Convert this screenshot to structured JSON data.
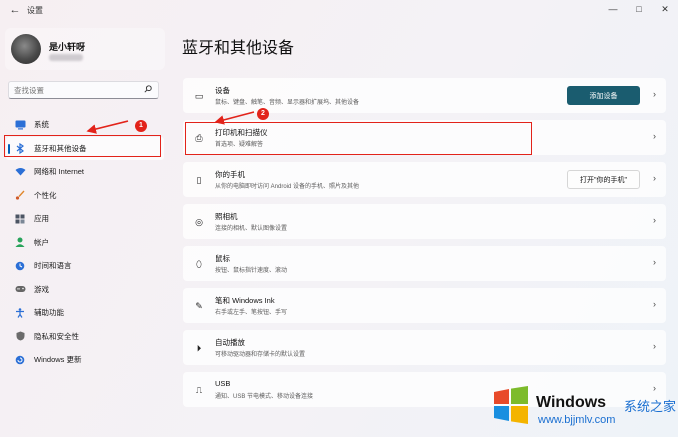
{
  "window": {
    "back_glyph": "←",
    "title": "设置",
    "minimize_glyph": "—",
    "maximize_glyph": "□",
    "close_glyph": "✕"
  },
  "profile": {
    "name": "是小轩呀"
  },
  "search": {
    "placeholder": "查找设置",
    "icon": "search-icon"
  },
  "sidebar": {
    "items": [
      {
        "label": "系统",
        "icon": "monitor-icon",
        "color": "#2b6fd6"
      },
      {
        "label": "蓝牙和其他设备",
        "icon": "bluetooth-icon",
        "color": "#2b6fd6",
        "active": true
      },
      {
        "label": "网络和 Internet",
        "icon": "wifi-icon",
        "color": "#2b6fd6"
      },
      {
        "label": "个性化",
        "icon": "brush-icon",
        "color": "#e0862a"
      },
      {
        "label": "应用",
        "icon": "apps-icon",
        "color": "#4c5563"
      },
      {
        "label": "帐户",
        "icon": "person-icon",
        "color": "#28a35a"
      },
      {
        "label": "时间和语言",
        "icon": "globe-clock-icon",
        "color": "#2b6fd6"
      },
      {
        "label": "游戏",
        "icon": "gamepad-icon",
        "color": "#666"
      },
      {
        "label": "辅助功能",
        "icon": "accessibility-icon",
        "color": "#2b6fd6"
      },
      {
        "label": "隐私和安全性",
        "icon": "shield-icon",
        "color": "#6b6b6b"
      },
      {
        "label": "Windows 更新",
        "icon": "update-icon",
        "color": "#2b6fd6"
      }
    ]
  },
  "main": {
    "title": "蓝牙和其他设备",
    "cards": [
      {
        "title": "设备",
        "desc": "鼠标、键盘、触笔、音频、显示器和扩展坞、其他设备",
        "icon": "devices-icon",
        "glyph": "▭",
        "button": "添加设备",
        "button_style": "primary"
      },
      {
        "title": "打印机和扫描仪",
        "desc": "首选项、疑难解答",
        "icon": "printer-icon",
        "glyph": "⎙"
      },
      {
        "title": "你的手机",
        "desc": "从你的电脑即时访问 Android 设备的手机、照片及其他",
        "icon": "phone-icon",
        "glyph": "▯",
        "button": "打开\"你的手机\"",
        "button_style": "secondary"
      },
      {
        "title": "照相机",
        "desc": "连接的相机、默认图像设置",
        "icon": "camera-icon",
        "glyph": "◎"
      },
      {
        "title": "鼠标",
        "desc": "按钮、鼠标指针速度、滚动",
        "icon": "mouse-icon",
        "glyph": "⬯"
      },
      {
        "title": "笔和 Windows Ink",
        "desc": "右手或左手、笔按钮、手写",
        "icon": "pen-icon",
        "glyph": "✎"
      },
      {
        "title": "自动播放",
        "desc": "可移动驱动器和存储卡的默认设置",
        "icon": "autoplay-icon",
        "glyph": "⏵"
      },
      {
        "title": "USB",
        "desc": "通知、USB 节电模式、移动设备连接",
        "icon": "usb-icon",
        "glyph": "⎍"
      }
    ]
  },
  "annotations": {
    "badge_1": "1",
    "badge_2": "2",
    "color": "#e2231a"
  },
  "watermark": {
    "brand": "Windows",
    "cn": "系统之家",
    "url": "www.bjjmlv.com"
  }
}
